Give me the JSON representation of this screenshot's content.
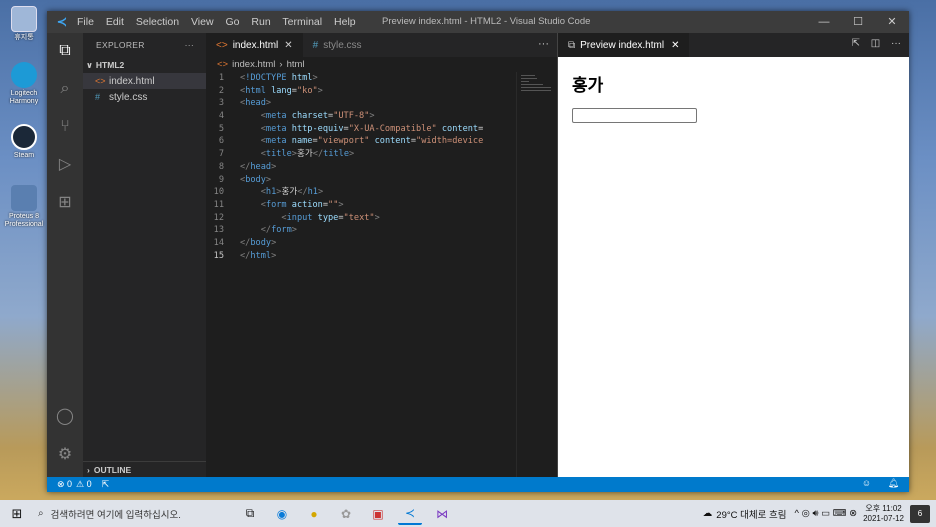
{
  "desktop": {
    "icons": [
      {
        "name": "recycle-bin",
        "label": "휴지통"
      },
      {
        "name": "logitech",
        "label": "Logitech Harmony"
      },
      {
        "name": "steam",
        "label": "Steam"
      },
      {
        "name": "proteus",
        "label": "Proteus 8 Professional"
      }
    ]
  },
  "window": {
    "title": "Preview index.html - HTML2 - Visual Studio Code",
    "menu": [
      "File",
      "Edit",
      "Selection",
      "View",
      "Go",
      "Run",
      "Terminal",
      "Help"
    ],
    "controls": {
      "minimize": "—",
      "maximize": "☐",
      "close": "✕"
    }
  },
  "sidebar": {
    "header": "EXPLORER",
    "header_more": "···",
    "folder": "HTML2",
    "files": [
      {
        "icon": "<>",
        "name": "index.html",
        "selected": true
      },
      {
        "icon": "#",
        "name": "style.css",
        "selected": false
      }
    ],
    "outline": "OUTLINE"
  },
  "editor": {
    "tabs": [
      {
        "icon": "<>",
        "label": "index.html",
        "close": "✕",
        "active": true
      },
      {
        "icon": "#",
        "label": "style.css",
        "active": false
      }
    ],
    "more": "···",
    "breadcrumb": {
      "file": "index.html",
      "separator": "›",
      "symbol": "html"
    },
    "current_line": 15,
    "lines": [
      {
        "n": "1",
        "html": "<span class=\"pu\">&lt;</span><span class=\"tg\">!DOCTYPE</span> <span class=\"at\">html</span><span class=\"pu\">&gt;</span>"
      },
      {
        "n": "2",
        "html": "<span class=\"pu\">&lt;</span><span class=\"tg\">html</span> <span class=\"at\">lang</span><span class=\"tx\">=</span><span class=\"st\">\"ko\"</span><span class=\"pu\">&gt;</span>"
      },
      {
        "n": "3",
        "html": "<span class=\"pu\">&lt;</span><span class=\"tg\">head</span><span class=\"pu\">&gt;</span>"
      },
      {
        "n": "4",
        "html": "    <span class=\"pu\">&lt;</span><span class=\"tg\">meta</span> <span class=\"at\">charset</span><span class=\"tx\">=</span><span class=\"st\">\"UTF-8\"</span><span class=\"pu\">&gt;</span>"
      },
      {
        "n": "5",
        "html": "    <span class=\"pu\">&lt;</span><span class=\"tg\">meta</span> <span class=\"at\">http-equiv</span><span class=\"tx\">=</span><span class=\"st\">\"X-UA-Compatible\"</span> <span class=\"at\">content</span><span class=\"tx\">=</span>"
      },
      {
        "n": "6",
        "html": "    <span class=\"pu\">&lt;</span><span class=\"tg\">meta</span> <span class=\"at\">name</span><span class=\"tx\">=</span><span class=\"st\">\"viewport\"</span> <span class=\"at\">content</span><span class=\"tx\">=</span><span class=\"st\">\"width=device</span>"
      },
      {
        "n": "7",
        "html": "    <span class=\"pu\">&lt;</span><span class=\"tg\">title</span><span class=\"pu\">&gt;</span><span class=\"tx\">홍가</span><span class=\"pu\">&lt;/</span><span class=\"tg\">title</span><span class=\"pu\">&gt;</span>"
      },
      {
        "n": "8",
        "html": "<span class=\"pu\">&lt;/</span><span class=\"tg\">head</span><span class=\"pu\">&gt;</span>"
      },
      {
        "n": "9",
        "html": "<span class=\"pu\">&lt;</span><span class=\"tg\">body</span><span class=\"pu\">&gt;</span>"
      },
      {
        "n": "10",
        "html": "    <span class=\"pu\">&lt;</span><span class=\"tg\">h1</span><span class=\"pu\">&gt;</span><span class=\"tx\">홍가</span><span class=\"pu\">&lt;/</span><span class=\"tg\">h1</span><span class=\"pu\">&gt;</span>"
      },
      {
        "n": "11",
        "html": "    <span class=\"pu\">&lt;</span><span class=\"tg\">form</span> <span class=\"at\">action</span><span class=\"tx\">=</span><span class=\"st\">\"\"</span><span class=\"pu\">&gt;</span>"
      },
      {
        "n": "12",
        "html": "        <span class=\"pu\">&lt;</span><span class=\"tg\">input</span> <span class=\"at\">type</span><span class=\"tx\">=</span><span class=\"st\">\"text\"</span><span class=\"pu\">&gt;</span>"
      },
      {
        "n": "13",
        "html": "    <span class=\"pu\">&lt;/</span><span class=\"tg\">form</span><span class=\"pu\">&gt;</span>"
      },
      {
        "n": "14",
        "html": "<span class=\"pu\">&lt;/</span><span class=\"tg\">body</span><span class=\"pu\">&gt;</span>"
      },
      {
        "n": "15",
        "html": "<span class=\"pu\">&lt;/</span><span class=\"tg\">html</span><span class=\"pu\">&gt;</span>"
      }
    ]
  },
  "preview": {
    "tab_label": "Preview index.html",
    "close": "✕",
    "heading": "홍가"
  },
  "statusbar": {
    "errors": "⊗ 0",
    "warnings": "⚠ 0"
  },
  "taskbar": {
    "search_placeholder": "검색하려면 여기에 입력하십시오.",
    "weather": "29°C 대체로 흐림",
    "time": "오후 11:02",
    "date": "2021-07-12",
    "notifications": "6"
  },
  "colors": {
    "accent": "#007acc",
    "editor_bg": "#1e1e1e",
    "sidebar_bg": "#252526",
    "activitybar_bg": "#333333",
    "titlebar_bg": "#3c3c3c"
  }
}
